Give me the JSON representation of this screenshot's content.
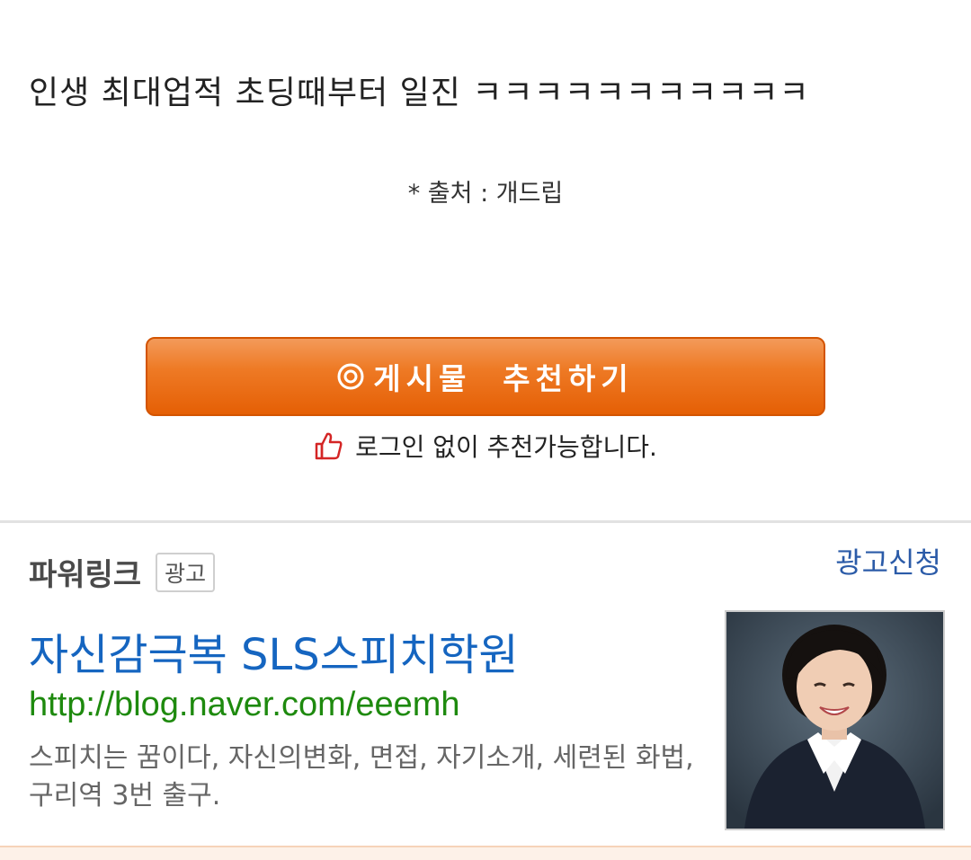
{
  "post": {
    "text": "인생 최대업적 초딩때부터 일진 ㅋㅋㅋㅋㅋㅋㅋㅋㅋㅋㅋ",
    "source": "* 출처 : 개드립"
  },
  "recommend": {
    "button_label": "게시물  추천하기",
    "note": "로그인 없이 추천가능합니다."
  },
  "ad": {
    "section_title": "파워링크",
    "badge": "광고",
    "apply_link": "광고신청",
    "title": "자신감극복 SLS스피치학원",
    "url": "http://blog.naver.com/eeemh",
    "description": "스피치는 꿈이다, 자신의변화, 면접, 자기소개, 세련된 화법, 구리역 3번 출구."
  },
  "colors": {
    "button": "#e86a10",
    "ad_title": "#1565c0",
    "ad_url": "#1e8a0e",
    "apply_link": "#2b5ba8"
  }
}
